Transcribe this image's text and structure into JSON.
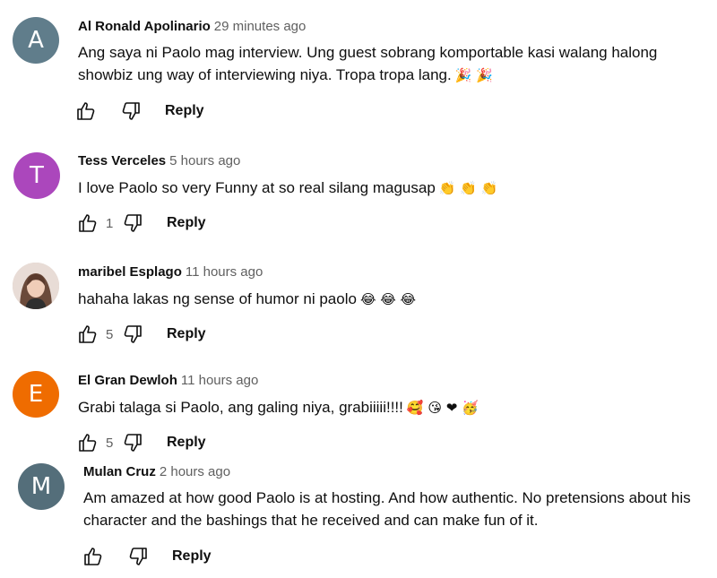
{
  "colors": {
    "avatar_a": "#607d8b",
    "avatar_t": "#ab47bc",
    "avatar_e": "#ef6c00",
    "avatar_m": "#546e7a"
  },
  "icons": {
    "like": "thumbs-up-outline-icon",
    "dislike": "thumbs-down-outline-icon"
  },
  "comments": [
    {
      "avatar_letter": "A",
      "author": "Al Ronald Apolinario",
      "time": "29 minutes ago",
      "text": "Ang saya ni Paolo mag interview. Ung guest sobrang komportable kasi walang halong showbiz ung way of interviewing niya. Tropa tropa lang.",
      "emoji": "🎉 🎉",
      "likes": "",
      "reply": "Reply"
    },
    {
      "avatar_letter": "T",
      "author": "Tess Verceles",
      "time": "5 hours ago",
      "text": "I love Paolo so very Funny at so real silang magusap",
      "emoji": "👏 👏 👏",
      "likes": "1",
      "reply": "Reply"
    },
    {
      "avatar_letter": "",
      "author": "maribel Esplago",
      "time": "11 hours ago",
      "text": "hahaha lakas ng sense of humor ni paolo",
      "emoji": "😂 😂 😂",
      "likes": "5",
      "reply": "Reply"
    },
    {
      "avatar_letter": "E",
      "author": "El Gran Dewloh",
      "time": "11 hours ago",
      "text": "Grabi talaga si Paolo, ang galing niya, grabiiiii!!!!",
      "emoji": "🥰 😘 ❤ 🥳",
      "likes": "5",
      "reply": "Reply"
    },
    {
      "avatar_letter": "M",
      "author": "Mulan Cruz",
      "time": "2 hours ago",
      "text": "Am amazed at how good Paolo is at hosting. And how authentic. No pretensions about his character and the bashings that he received and can make fun of it.",
      "emoji": "",
      "likes": "",
      "reply": "Reply"
    }
  ]
}
